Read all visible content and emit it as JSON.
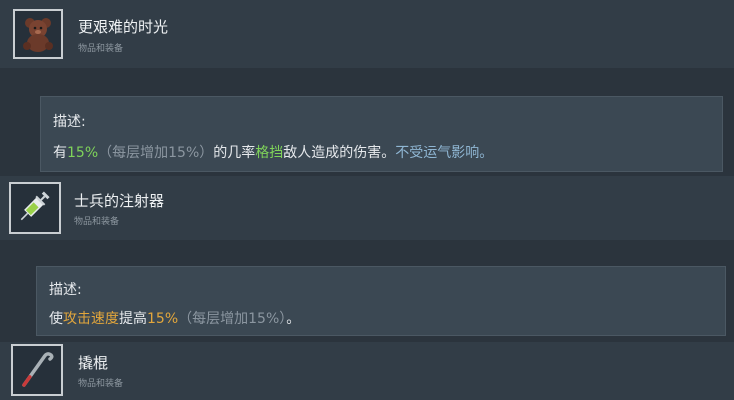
{
  "items": [
    {
      "title": "更艰难的时光",
      "subtitle": "物品和装备",
      "icon": "teddy-bear-icon",
      "desc_label": "描述:",
      "desc": {
        "t1": "有",
        "pct": "15%",
        "stack": "（每层增加15%）",
        "t2": "的几率",
        "keyword": "格挡",
        "t3": "敌人造成的伤害。",
        "note": "不受运气影响。"
      }
    },
    {
      "title": "士兵的注射器",
      "subtitle": "物品和装备",
      "icon": "syringe-icon",
      "desc_label": "描述:",
      "desc": {
        "t1": "使",
        "keyword": "攻击速度",
        "t2": "提高",
        "pct": "15%",
        "stack": "（每层增加15%）",
        "t3": "。"
      }
    },
    {
      "title": "撬棍",
      "subtitle": "物品和装备",
      "icon": "crowbar-icon"
    }
  ],
  "colors": {
    "highlight_green": "#7fd35a",
    "highlight_orange": "#e2a63c",
    "muted_gray": "#8b96a0",
    "note_blue": "#8fb6d3"
  }
}
